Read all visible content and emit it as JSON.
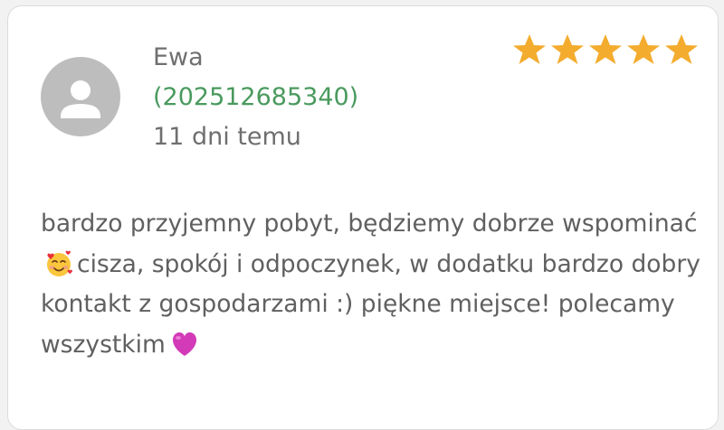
{
  "review": {
    "author": "Ewa",
    "code": "(202512685340)",
    "time_ago": "11 dni temu",
    "rating": 5,
    "rating_max": 5,
    "text_part1": "bardzo przyjemny pobyt, będziemy dobrze wspominać",
    "emoji1": "smiling-face-with-hearts",
    "text_part2": "cisza, spokój i odpoczynek, w dodatku bardzo dobry kontakt z gospodarzami :) piękne miejsce! polecamy wszystkim",
    "emoji2": "purple-heart"
  },
  "colors": {
    "star": "#f4ac2e",
    "code": "#4a9a5e",
    "text": "#606060",
    "avatar_bg": "#bdbdbd"
  }
}
